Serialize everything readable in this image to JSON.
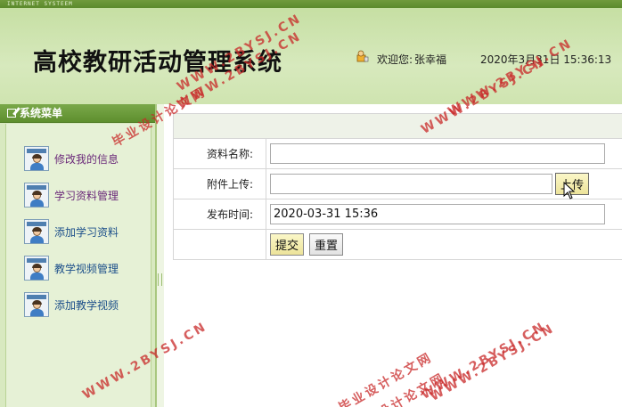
{
  "topbar": {
    "label": "INTERNET SYSTEEM"
  },
  "header": {
    "title": "高校教研活动管理系统",
    "welcome_label": "欢迎您:",
    "username": "张幸福",
    "datetime": "2020年3月31日 15:36:13"
  },
  "sidebar": {
    "heading": "系统菜单",
    "items": [
      {
        "label": "修改我的信息"
      },
      {
        "label": "学习资料管理"
      },
      {
        "label": "添加学习资料"
      },
      {
        "label": "教学视频管理"
      },
      {
        "label": "添加教学视频"
      }
    ]
  },
  "form": {
    "fields": [
      {
        "label": "资料名称:",
        "value": ""
      },
      {
        "label": "附件上传:",
        "value": ""
      },
      {
        "label": "发布时间:",
        "value": "2020-03-31 15:36"
      }
    ],
    "upload_label": "上传",
    "submit_label": "提交",
    "reset_label": "重置"
  },
  "watermarks": [
    "WWW.2BYSJ.CN",
    "毕业设计论文网",
    "WWW.2BYSJ.CN",
    "WWW.2BYSJ.CN",
    "WWW.2BYSJ.CN",
    "毕业设计论文网",
    "WWW.2BYSJ.CN",
    "WWW.2BYSJ.CN",
    "WWW.2BYSJ.CN",
    "设计论文网"
  ],
  "colors": {
    "header_bg": "#cfe4b0",
    "menu_head": "#5e8f2e",
    "menu_text": "#6b2a7a",
    "watermark": "#c82828"
  }
}
